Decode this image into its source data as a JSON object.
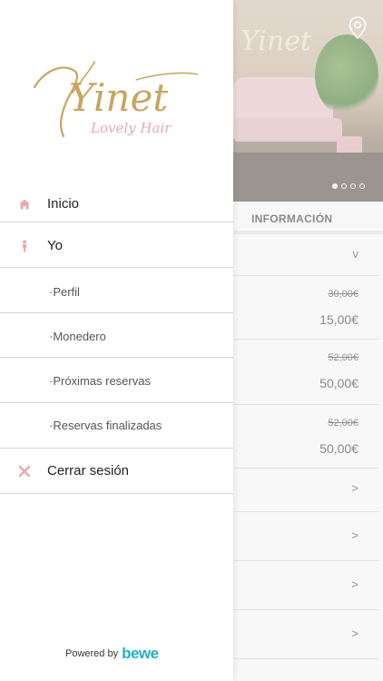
{
  "drawer": {
    "logo": {
      "brand": "Yinet",
      "tagline": "Lovely Hair"
    },
    "menu": [
      {
        "label": "Inicio",
        "icon": "home-icon"
      },
      {
        "label": "Yo",
        "icon": "person-icon"
      },
      {
        "label": "·Perfil"
      },
      {
        "label": "·Monedero"
      },
      {
        "label": "·Próximas reservas"
      },
      {
        "label": "·Reservas finalizadas"
      },
      {
        "label": "Cerrar sesión",
        "icon": "close-icon"
      }
    ],
    "footer": {
      "powered_label": "Powered by",
      "brand": "bewe"
    }
  },
  "background": {
    "tab_label": "INFORMACIÓN",
    "dropdown_chevron": "v",
    "prices": [
      {
        "old": "30,00€",
        "new": "15,00€"
      },
      {
        "old": "52,00€",
        "new": "50,00€"
      },
      {
        "old": "52,00€",
        "new": "50,00€"
      }
    ],
    "row_chevron": ">"
  },
  "colors": {
    "accent_gold": "#c9a45c",
    "accent_pink": "#e9a9ae",
    "bewe_teal": "#1fb2c1"
  }
}
